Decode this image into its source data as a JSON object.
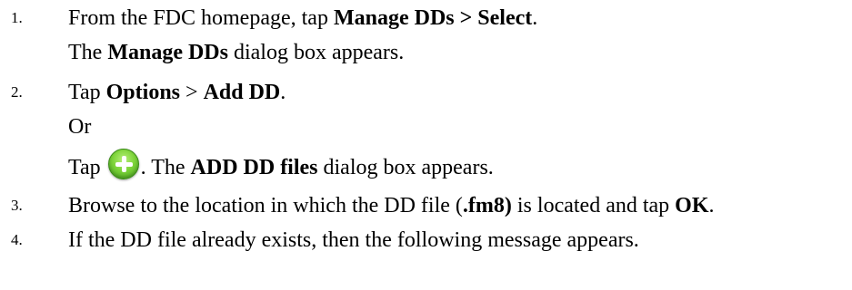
{
  "steps": [
    {
      "number": "1.",
      "line1": {
        "pre": "From the FDC homepage, tap ",
        "bold": "Manage DDs > Select",
        "post": "."
      },
      "line2": {
        "pre": "The ",
        "bold": "Manage DDs",
        "post": " dialog box appears."
      }
    },
    {
      "number": "2.",
      "line1": {
        "pre": "Tap ",
        "bold1": "Options",
        "mid": " > ",
        "bold2": "Add DD",
        "post": "."
      },
      "or_text": "Or",
      "line3": {
        "pre": "Tap ",
        "icon": "green-plus-icon",
        "mid": ". The ",
        "bold": "ADD DD files",
        "post": " dialog box appears."
      }
    },
    {
      "number": "3.",
      "line1": {
        "pre": "Browse to the location in which the DD file (",
        "bold1": ".fm8)",
        "mid": " is located and tap ",
        "bold2": "OK",
        "post": "."
      }
    },
    {
      "number": "4.",
      "line1": {
        "text": "If the DD file already exists, then the following message appears."
      }
    }
  ],
  "colors": {
    "text": "#000000",
    "background": "#ffffff",
    "icon_green": "#7ed43a"
  }
}
